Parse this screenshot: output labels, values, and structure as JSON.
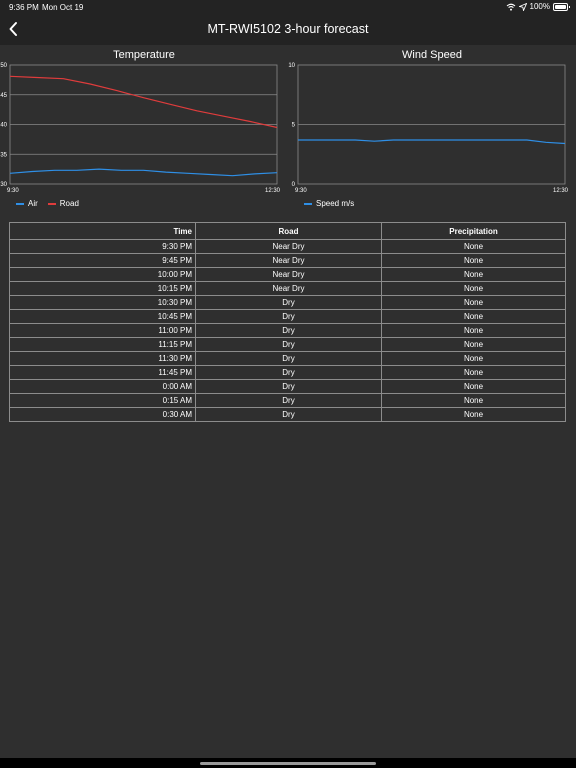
{
  "status": {
    "time": "9:36 PM",
    "date": "Mon Oct 19",
    "battery": "100%"
  },
  "nav": {
    "title": "MT-RWI5102 3-hour forecast"
  },
  "colors": {
    "air": "#2f8fe6",
    "road": "#e03c3c",
    "wind": "#2f8fe6",
    "grid": "#8a8a8a"
  },
  "chart_data": [
    {
      "type": "line",
      "title": "Temperature",
      "x_start_label": "9:30",
      "x_end_label": "12:30",
      "ylim": [
        30,
        50
      ],
      "yticks": [
        30,
        35,
        40,
        45,
        50
      ],
      "grid": true,
      "legend_position": "bottom-left",
      "series": [
        {
          "name": "Air",
          "color": "#2f8fe6",
          "values": [
            31.8,
            32.1,
            32.3,
            32.3,
            32.5,
            32.3,
            32.3,
            32.0,
            31.8,
            31.6,
            31.4,
            31.7,
            31.9
          ]
        },
        {
          "name": "Road",
          "color": "#e03c3c",
          "values": [
            48.1,
            47.9,
            47.7,
            46.8,
            45.7,
            44.5,
            43.4,
            42.3,
            41.4,
            40.5,
            39.5
          ]
        }
      ]
    },
    {
      "type": "line",
      "title": "Wind Speed",
      "x_start_label": "9:30",
      "x_end_label": "12:30",
      "ylim": [
        0,
        10
      ],
      "yticks": [
        0,
        5,
        10
      ],
      "grid": true,
      "legend_position": "bottom-left",
      "series": [
        {
          "name": "Speed m/s",
          "color": "#2f8fe6",
          "values": [
            3.7,
            3.7,
            3.7,
            3.7,
            3.6,
            3.7,
            3.7,
            3.7,
            3.7,
            3.7,
            3.7,
            3.7,
            3.7,
            3.5,
            3.4
          ]
        }
      ]
    }
  ],
  "table": {
    "headers": [
      "Time",
      "Road",
      "Precipitation"
    ],
    "rows": [
      [
        "9:30 PM",
        "Near Dry",
        "None"
      ],
      [
        "9:45 PM",
        "Near Dry",
        "None"
      ],
      [
        "10:00 PM",
        "Near Dry",
        "None"
      ],
      [
        "10:15 PM",
        "Near Dry",
        "None"
      ],
      [
        "10:30 PM",
        "Dry",
        "None"
      ],
      [
        "10:45 PM",
        "Dry",
        "None"
      ],
      [
        "11:00 PM",
        "Dry",
        "None"
      ],
      [
        "11:15 PM",
        "Dry",
        "None"
      ],
      [
        "11:30 PM",
        "Dry",
        "None"
      ],
      [
        "11:45 PM",
        "Dry",
        "None"
      ],
      [
        "0:00 AM",
        "Dry",
        "None"
      ],
      [
        "0:15 AM",
        "Dry",
        "None"
      ],
      [
        "0:30 AM",
        "Dry",
        "None"
      ]
    ]
  }
}
